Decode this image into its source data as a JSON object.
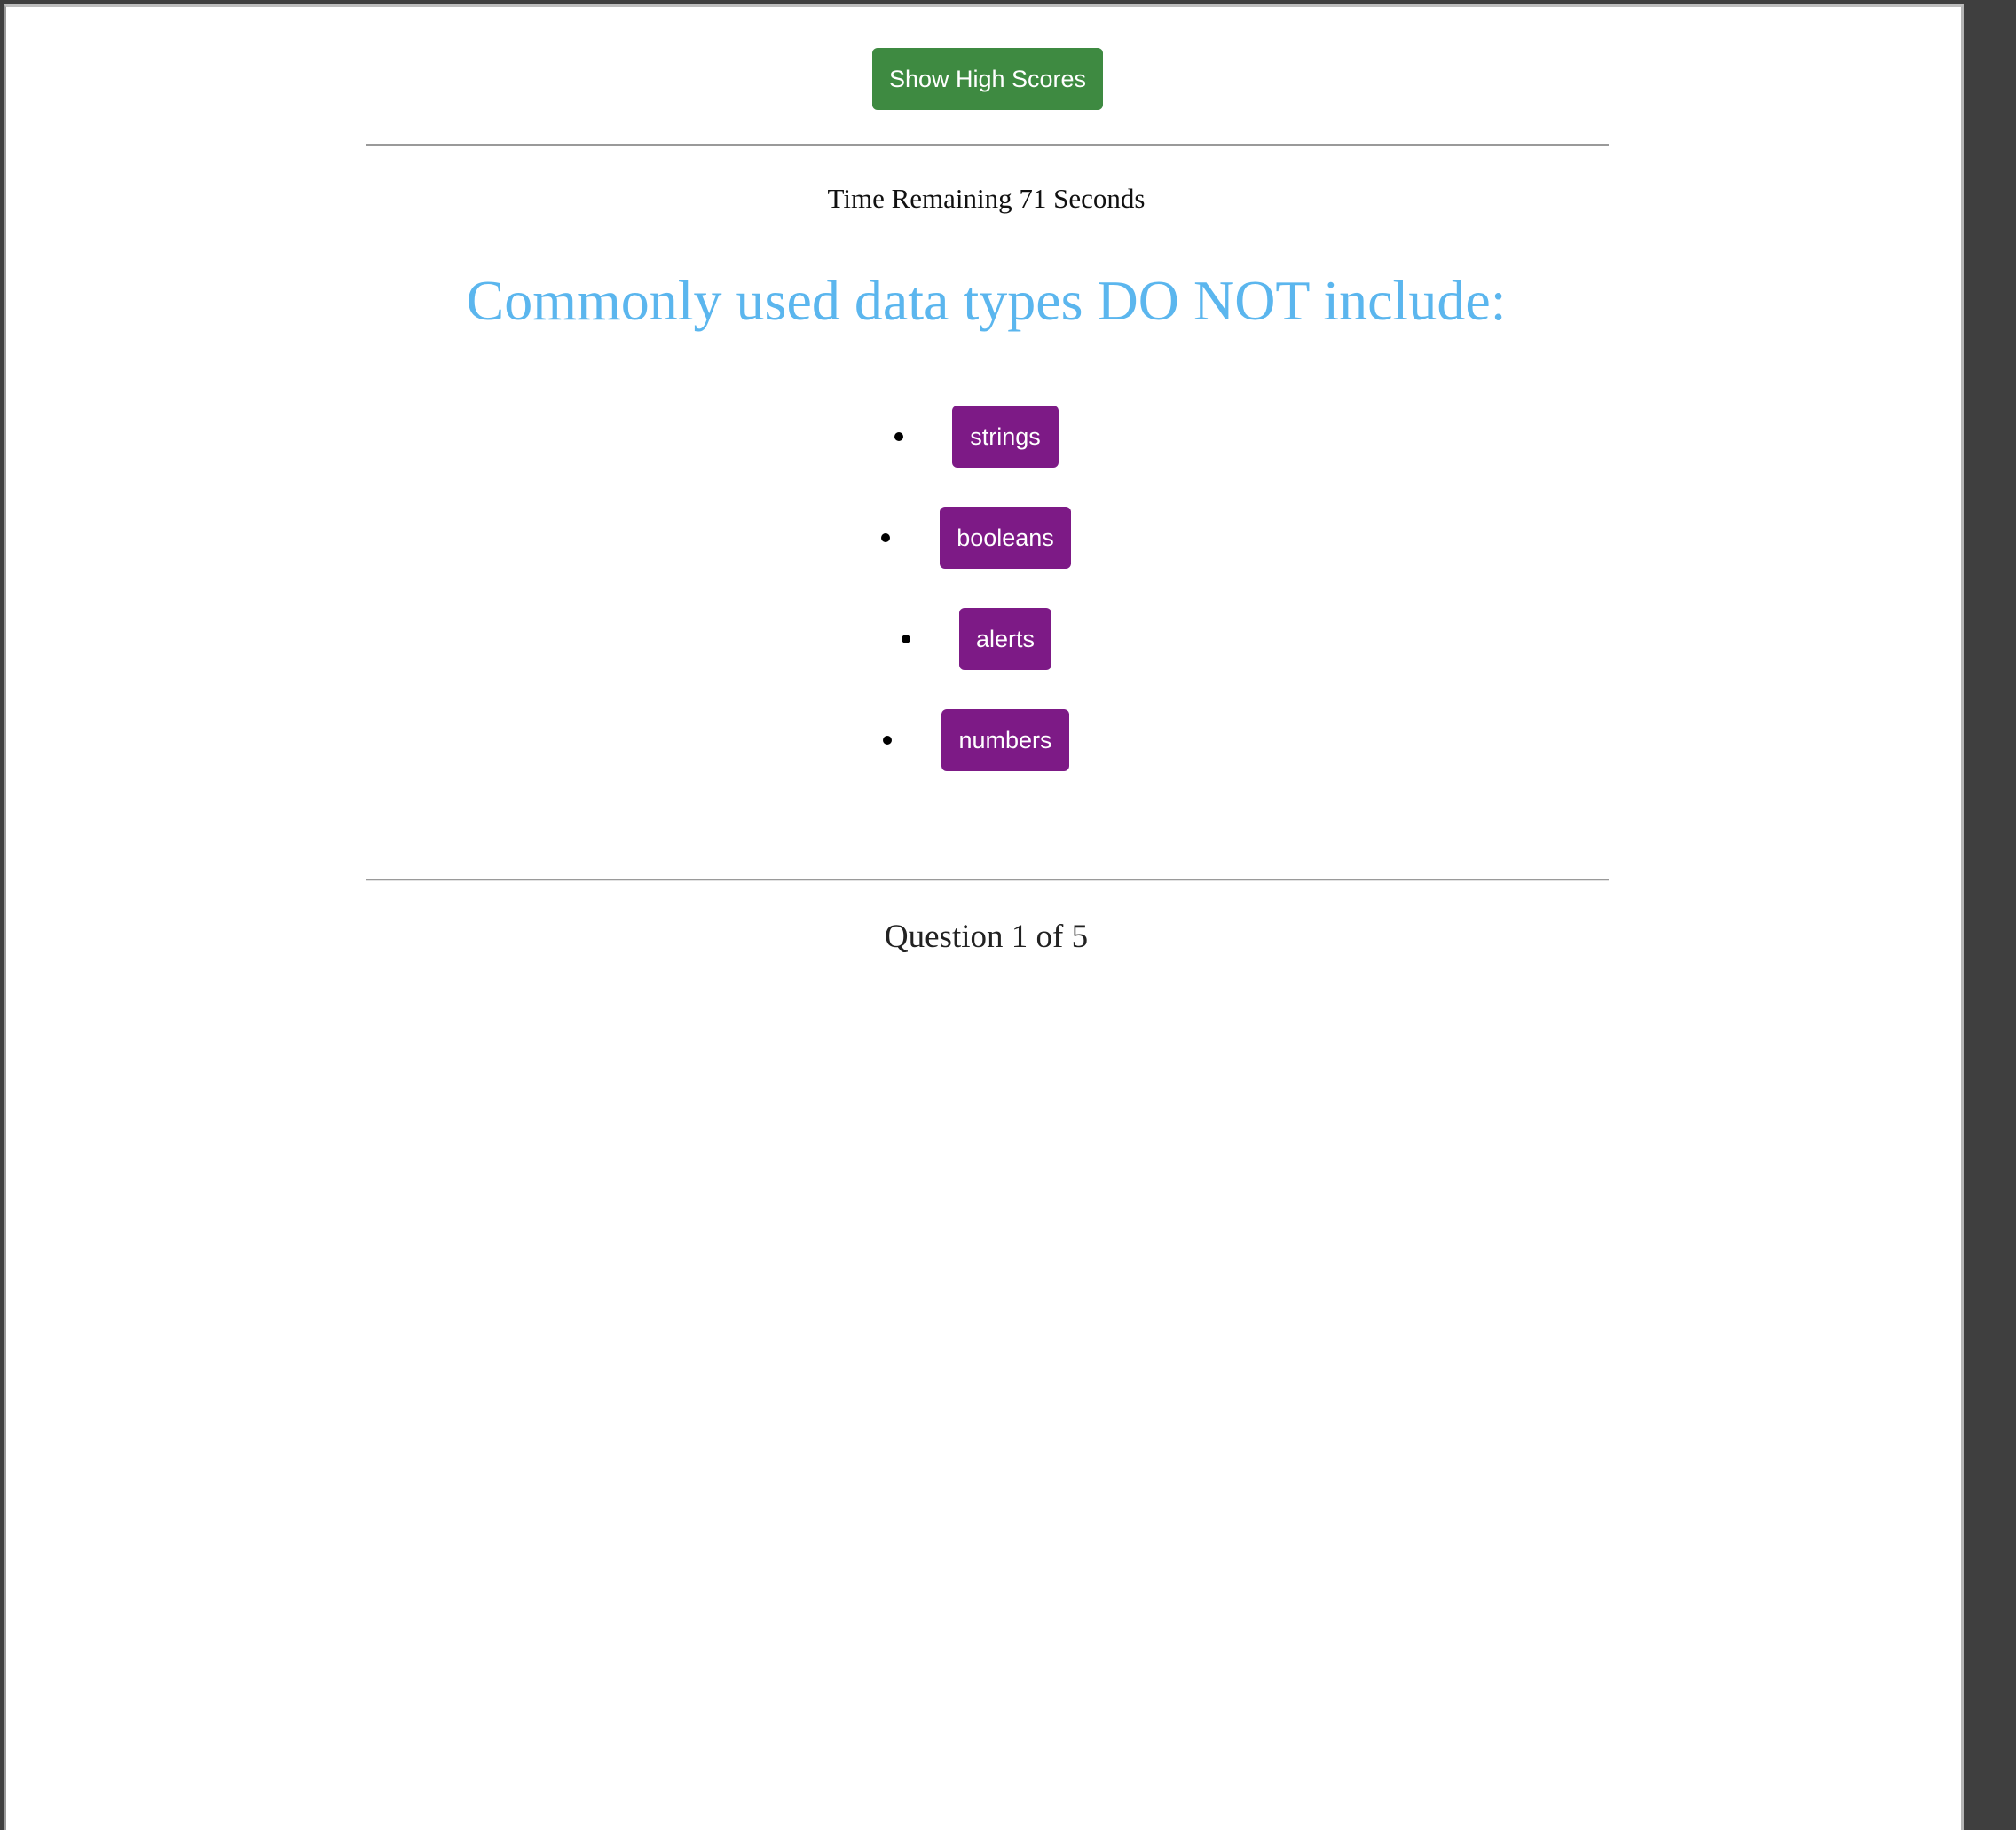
{
  "header": {
    "high_scores_label": "Show High Scores"
  },
  "quiz": {
    "timer_text": "Time Remaining 71 Seconds",
    "question": "Commonly used data types DO NOT include:",
    "answers": [
      {
        "label": "strings"
      },
      {
        "label": "booleans"
      },
      {
        "label": "alerts"
      },
      {
        "label": "numbers"
      }
    ],
    "progress_text": "Question 1 of 5"
  },
  "colors": {
    "high_scores_button": "#3e8a41",
    "answer_button": "#7d1a86",
    "question_text": "#5bb6ee"
  }
}
